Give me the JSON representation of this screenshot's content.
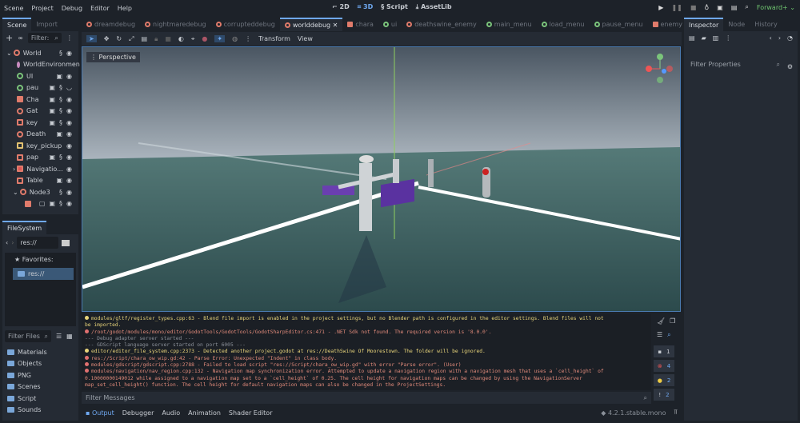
{
  "menu": [
    "Scene",
    "Project",
    "Debug",
    "Editor",
    "Help"
  ],
  "modes": [
    "2D",
    "3D",
    "Script",
    "AssetLib"
  ],
  "renderer": "Forward+",
  "scene_dock": {
    "tabs": [
      "Scene",
      "Import"
    ],
    "filter_placeholder": "Filter:",
    "nodes": [
      "World",
      "WorldEnvironmen",
      "UI",
      "pau",
      "Cha",
      "Gat",
      "key",
      "Death",
      "key_pickup",
      "pap",
      "Navigatio...",
      "Table",
      "Node3",
      ""
    ]
  },
  "filesystem": {
    "tab": "FileSystem",
    "path": "res://",
    "favorites": "Favorites:",
    "root": "res://",
    "filter_placeholder": "Filter Files",
    "folders": [
      "Materials",
      "Objects",
      "PNG",
      "Scenes",
      "Script",
      "Sounds"
    ]
  },
  "scene_tabs": [
    "dreamdebug",
    "nightmaredebug",
    "corrupteddebug",
    "worlddebug",
    "chara",
    "ui",
    "deathswine_enemy",
    "main_menu",
    "load_menu",
    "pause_menu",
    "enemy"
  ],
  "viewport": {
    "menus": [
      "Transform",
      "View"
    ],
    "perspective": "Perspective",
    "gizmo": {
      "y": "Y",
      "x": "X",
      "z": "Z"
    }
  },
  "output": {
    "lines": [
      {
        "t": "w",
        "s": "modules/gltf/register_types.cpp:63 - Blend file import is enabled in the project settings, but no Blender path is configured in the editor settings. Blend files will not"
      },
      {
        "t": "w",
        "s": "be imported.",
        "cont": true
      },
      {
        "t": "e",
        "s": "/root/godot/modules/mono/editor/GodotTools/GodotTools/GodotSharpEditor.cs:471 - .NET Sdk not found. The required version is '8.0.0'."
      },
      {
        "t": "c",
        "s": "--- Debug adapter server started ---",
        "cont": true
      },
      {
        "t": "c",
        "s": "--- GDScript language server started on port 6005 ---",
        "cont": true
      },
      {
        "t": "w",
        "s": "editor/editor_file_system.cpp:2373 - Detected another project.godot at res://DeathSwine Of Moorestown. The folder will be ignored."
      },
      {
        "t": "e",
        "s": "res://Script/chara_ow_wip.gd:42 - Parse Error: Unexpected \"Indent\" in class body."
      },
      {
        "t": "e",
        "s": "modules/gdscript/gdscript.cpp:2788 - Failed to load script \"res://Script/chara_ow_wip.gd\" with error \"Parse error\". (User)"
      },
      {
        "t": "e",
        "s": "modules/navigation/nav_region.cpp:132 - Navigation map synchronization error. Attempted to update a navigation region with a navigation mesh that uses a `cell_height` of"
      },
      {
        "t": "e",
        "s": "0.10000000149012 while assigned to a navigation map set to a `cell_height` of 0.25. The cell height for navigation maps can be changed by using the NavigationServer",
        "cont": true
      },
      {
        "t": "e",
        "s": "map_set_cell_height() function. The cell height for default navigation maps can also be changed in the ProjectSettings.",
        "cont": true
      }
    ],
    "filter_placeholder": "Filter Messages",
    "counts": {
      "messages": "1",
      "errors": "4",
      "warnings": "2",
      "extra": "2"
    }
  },
  "bottom_tabs": [
    "Output",
    "Debugger",
    "Audio",
    "Animation",
    "Shader Editor"
  ],
  "version": "4.2.1.stable.mono",
  "inspector": {
    "tabs": [
      "Inspector",
      "Node",
      "History"
    ],
    "filter_placeholder": "Filter Properties"
  }
}
